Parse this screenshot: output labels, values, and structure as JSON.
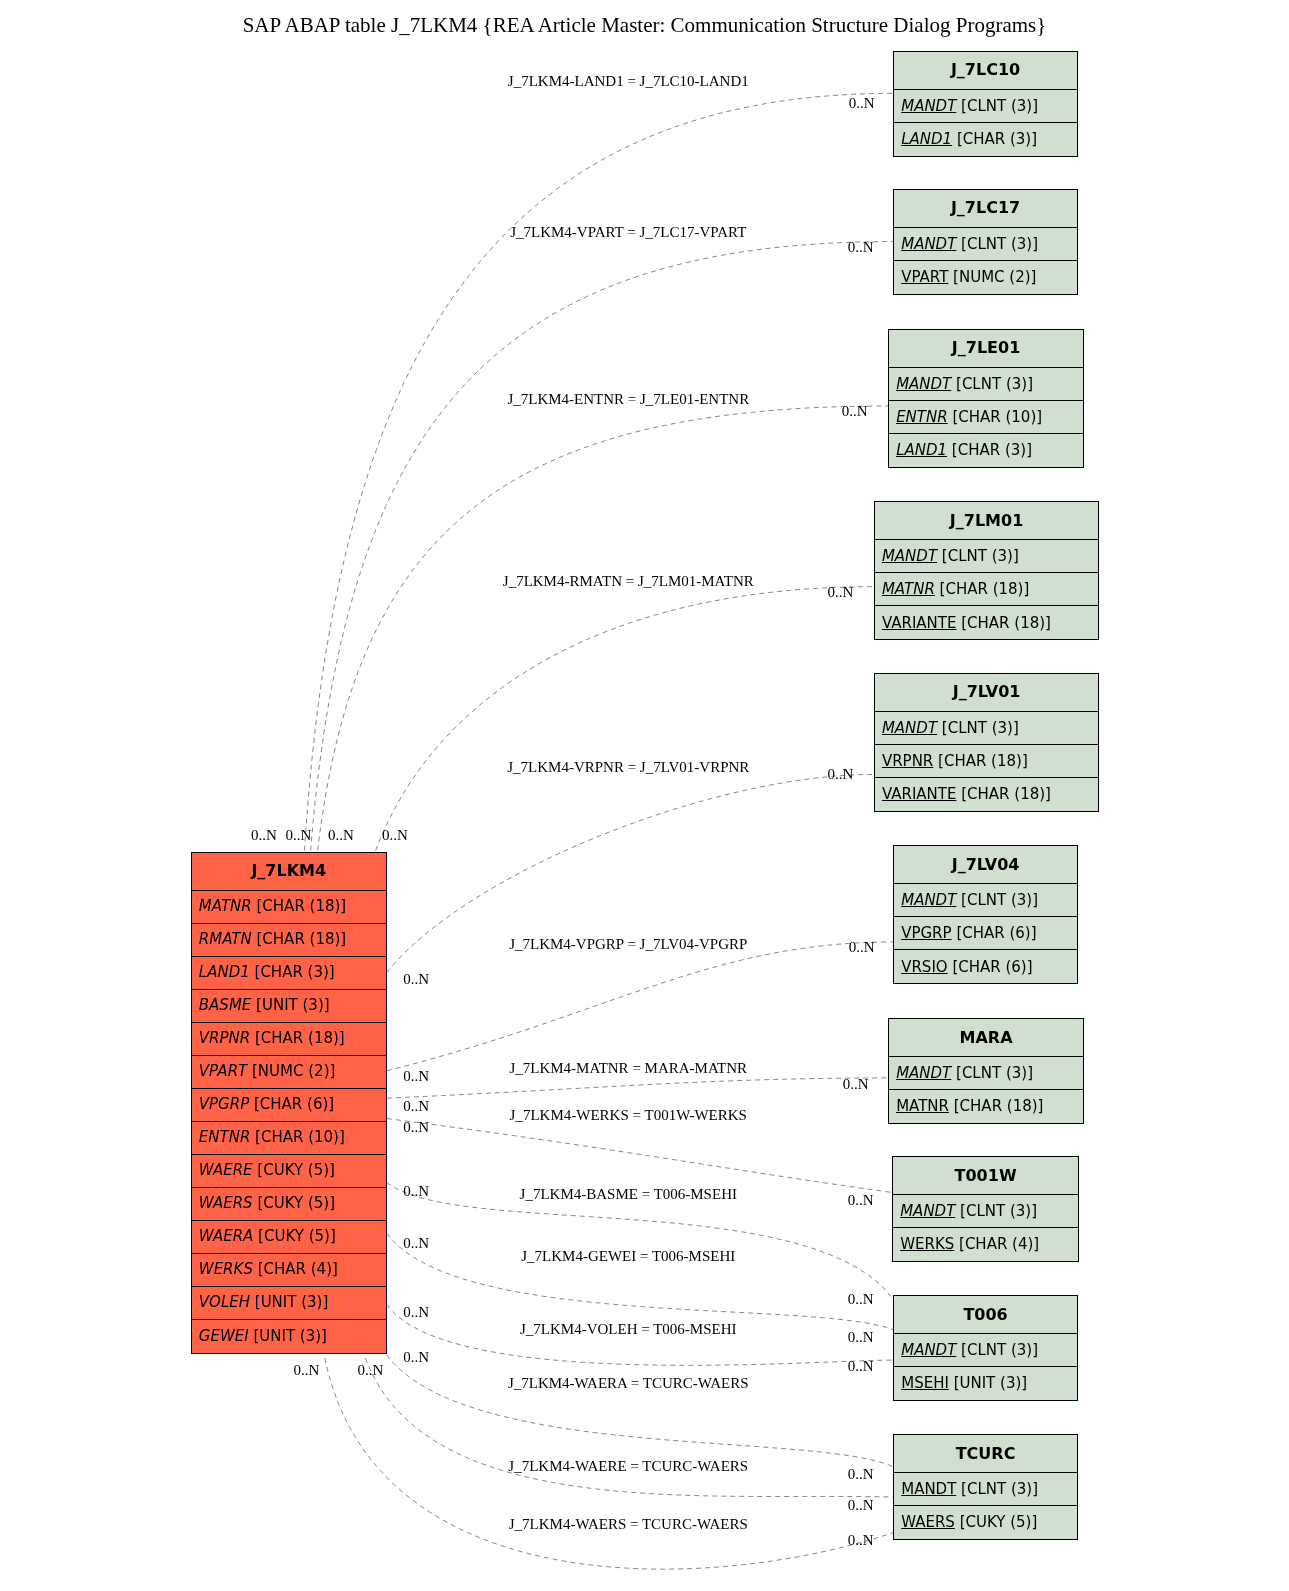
{
  "title": "SAP ABAP table J_7LKM4 {REA Article Master: Communication Structure Dialog Programs}",
  "main_table": {
    "name": "J_7LKM4",
    "fields": [
      {
        "name": "MATNR",
        "type": "[CHAR (18)]",
        "key": false,
        "foreign_key": true
      },
      {
        "name": "RMATN",
        "type": "[CHAR (18)]",
        "key": false,
        "foreign_key": true
      },
      {
        "name": "LAND1",
        "type": "[CHAR (3)]",
        "key": false,
        "foreign_key": true
      },
      {
        "name": "BASME",
        "type": "[UNIT (3)]",
        "key": false,
        "foreign_key": true
      },
      {
        "name": "VRPNR",
        "type": "[CHAR (18)]",
        "key": false,
        "foreign_key": true
      },
      {
        "name": "VPART",
        "type": "[NUMC (2)]",
        "key": false,
        "foreign_key": true
      },
      {
        "name": "VPGRP",
        "type": "[CHAR (6)]",
        "key": false,
        "foreign_key": true
      },
      {
        "name": "ENTNR",
        "type": "[CHAR (10)]",
        "key": false,
        "foreign_key": true
      },
      {
        "name": "WAERE",
        "type": "[CUKY (5)]",
        "key": false,
        "foreign_key": true
      },
      {
        "name": "WAERS",
        "type": "[CUKY (5)]",
        "key": false,
        "foreign_key": true
      },
      {
        "name": "WAERA",
        "type": "[CUKY (5)]",
        "key": false,
        "foreign_key": true
      },
      {
        "name": "WERKS",
        "type": "[CHAR (4)]",
        "key": false,
        "foreign_key": true
      },
      {
        "name": "VOLEH",
        "type": "[UNIT (3)]",
        "key": false,
        "foreign_key": true
      },
      {
        "name": "GEWEI",
        "type": "[UNIT (3)]",
        "key": false,
        "foreign_key": true
      }
    ]
  },
  "tables": [
    {
      "name": "J_7LC10",
      "fields": [
        {
          "name": "MANDT",
          "type": "[CLNT (3)]",
          "key": true,
          "foreign_key": true
        },
        {
          "name": "LAND1",
          "type": "[CHAR (3)]",
          "key": true,
          "foreign_key": true
        }
      ]
    },
    {
      "name": "J_7LC17",
      "fields": [
        {
          "name": "MANDT",
          "type": "[CLNT (3)]",
          "key": true,
          "foreign_key": true
        },
        {
          "name": "VPART",
          "type": "[NUMC (2)]",
          "key": true,
          "foreign_key": false
        }
      ]
    },
    {
      "name": "J_7LE01",
      "fields": [
        {
          "name": "MANDT",
          "type": "[CLNT (3)]",
          "key": true,
          "foreign_key": true
        },
        {
          "name": "ENTNR",
          "type": "[CHAR (10)]",
          "key": true,
          "foreign_key": true
        },
        {
          "name": "LAND1",
          "type": "[CHAR (3)]",
          "key": true,
          "foreign_key": true
        }
      ]
    },
    {
      "name": "J_7LM01",
      "fields": [
        {
          "name": "MANDT",
          "type": "[CLNT (3)]",
          "key": true,
          "foreign_key": true
        },
        {
          "name": "MATNR",
          "type": "[CHAR (18)]",
          "key": true,
          "foreign_key": true
        },
        {
          "name": "VARIANTE",
          "type": "[CHAR (18)]",
          "key": true,
          "foreign_key": false
        }
      ]
    },
    {
      "name": "J_7LV01",
      "fields": [
        {
          "name": "MANDT",
          "type": "[CLNT (3)]",
          "key": true,
          "foreign_key": true
        },
        {
          "name": "VRPNR",
          "type": "[CHAR (18)]",
          "key": true,
          "foreign_key": false
        },
        {
          "name": "VARIANTE",
          "type": "[CHAR (18)]",
          "key": true,
          "foreign_key": false
        }
      ]
    },
    {
      "name": "J_7LV04",
      "fields": [
        {
          "name": "MANDT",
          "type": "[CLNT (3)]",
          "key": true,
          "foreign_key": true
        },
        {
          "name": "VPGRP",
          "type": "[CHAR (6)]",
          "key": true,
          "foreign_key": false
        },
        {
          "name": "VRSIO",
          "type": "[CHAR (6)]",
          "key": true,
          "foreign_key": false
        }
      ]
    },
    {
      "name": "MARA",
      "fields": [
        {
          "name": "MANDT",
          "type": "[CLNT (3)]",
          "key": true,
          "foreign_key": true
        },
        {
          "name": "MATNR",
          "type": "[CHAR (18)]",
          "key": true,
          "foreign_key": false
        }
      ]
    },
    {
      "name": "T001W",
      "fields": [
        {
          "name": "MANDT",
          "type": "[CLNT (3)]",
          "key": true,
          "foreign_key": true
        },
        {
          "name": "WERKS",
          "type": "[CHAR (4)]",
          "key": true,
          "foreign_key": false
        }
      ]
    },
    {
      "name": "T006",
      "fields": [
        {
          "name": "MANDT",
          "type": "[CLNT (3)]",
          "key": true,
          "foreign_key": true
        },
        {
          "name": "MSEHI",
          "type": "[UNIT (3)]",
          "key": true,
          "foreign_key": false
        }
      ]
    },
    {
      "name": "TCURC",
      "fields": [
        {
          "name": "MANDT",
          "type": "[CLNT (3)]",
          "key": true,
          "foreign_key": false
        },
        {
          "name": "WAERS",
          "type": "[CUKY (5)]",
          "key": true,
          "foreign_key": false
        }
      ]
    }
  ],
  "relationships": [
    {
      "label": "J_7LKM4-LAND1 = J_7LC10-LAND1",
      "source_cardinality": "0..N",
      "target_cardinality": "0..N"
    },
    {
      "label": "J_7LKM4-VPART = J_7LC17-VPART",
      "source_cardinality": "0..N",
      "target_cardinality": "0..N"
    },
    {
      "label": "J_7LKM4-ENTNR = J_7LE01-ENTNR",
      "source_cardinality": "0..N",
      "target_cardinality": "0..N"
    },
    {
      "label": "J_7LKM4-RMATN = J_7LM01-MATNR",
      "source_cardinality": "0..N",
      "target_cardinality": "0..N"
    },
    {
      "label": "J_7LKM4-VRPNR = J_7LV01-VRPNR",
      "source_cardinality": "0..N",
      "target_cardinality": "0..N"
    },
    {
      "label": "J_7LKM4-VPGRP = J_7LV04-VPGRP",
      "source_cardinality": "0..N",
      "target_cardinality": "0..N"
    },
    {
      "label": "J_7LKM4-MATNR = MARA-MATNR",
      "source_cardinality": "0..N",
      "target_cardinality": "0..N"
    },
    {
      "label": "J_7LKM4-WERKS = T001W-WERKS",
      "source_cardinality": "0..N",
      "target_cardinality": "0..N"
    },
    {
      "label": "J_7LKM4-BASME = T006-MSEHI",
      "source_cardinality": "0..N",
      "target_cardinality": "0..N"
    },
    {
      "label": "J_7LKM4-GEWEI = T006-MSEHI",
      "source_cardinality": "0..N",
      "target_cardinality": "0..N"
    },
    {
      "label": "J_7LKM4-VOLEH = T006-MSEHI",
      "source_cardinality": "0..N",
      "target_cardinality": "0..N"
    },
    {
      "label": "J_7LKM4-WAERA = TCURC-WAERS",
      "source_cardinality": "0..N",
      "target_cardinality": "0..N"
    },
    {
      "label": "J_7LKM4-WAERE = TCURC-WAERS",
      "source_cardinality": "0..N",
      "target_cardinality": "0..N"
    },
    {
      "label": "J_7LKM4-WAERS = TCURC-WAERS",
      "source_cardinality": "0..N",
      "target_cardinality": "0..N"
    }
  ]
}
